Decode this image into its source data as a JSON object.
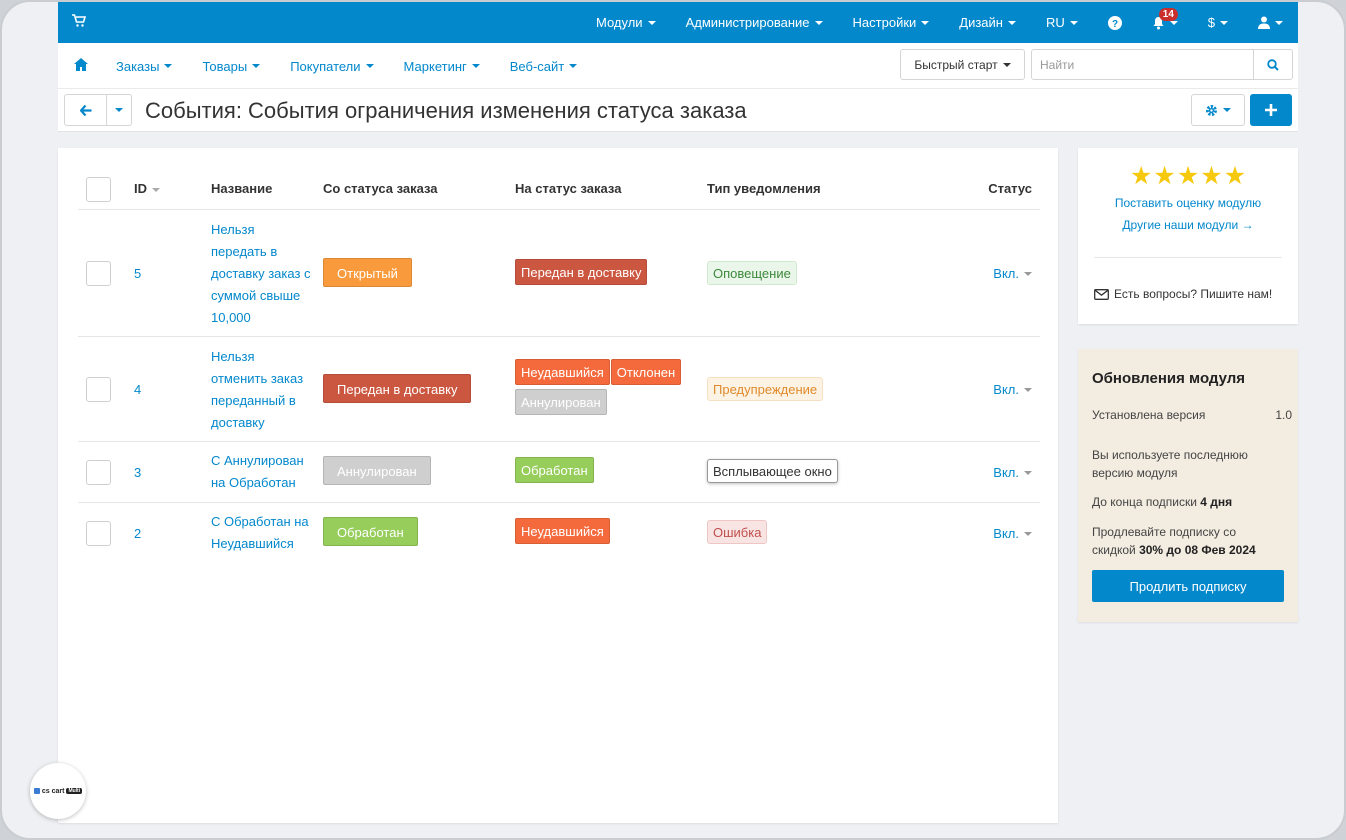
{
  "topbar": {
    "menu": [
      {
        "label": "Модули"
      },
      {
        "label": "Администрирование"
      },
      {
        "label": "Настройки"
      },
      {
        "label": "Дизайн"
      },
      {
        "label": "RU"
      }
    ],
    "notifications_count": "14",
    "currency": "$"
  },
  "subnav": {
    "links": [
      "Заказы",
      "Товары",
      "Покупатели",
      "Маркетинг",
      "Веб-сайт"
    ],
    "quick_start": "Быстрый старт",
    "search_placeholder": "Найти"
  },
  "page": {
    "title": "События: События ограничения изменения статуса заказа"
  },
  "table": {
    "headers": {
      "id": "ID",
      "name": "Название",
      "from_status": "Со статуса заказа",
      "to_status": "На статус заказа",
      "notification_type": "Тип уведомления",
      "status": "Статус"
    },
    "rows": [
      {
        "id": "5",
        "name": "Нельзя передать в доставку заказ с суммой свыше 10,000",
        "from": [
          {
            "label": "Открытый",
            "color": "#f99b3d"
          }
        ],
        "to": [
          {
            "label": "Передан в доставку",
            "color": "#cc5741"
          }
        ],
        "notification": {
          "label": "Оповещение",
          "fg": "#3c8a3c",
          "bg": "#eaf6ea",
          "border": "#cfe9cf"
        },
        "status": "Вкл."
      },
      {
        "id": "4",
        "name": "Нельзя отменить заказ переданный в доставку",
        "from": [
          {
            "label": "Передан в доставку",
            "color": "#cc5741"
          }
        ],
        "to": [
          {
            "label": "Неудавшийся",
            "color": "#f46a3c"
          },
          {
            "label": "Отклонен",
            "color": "#f46a3c"
          },
          {
            "label": "Аннулирован",
            "color": "#cfcfcf"
          }
        ],
        "notification": {
          "label": "Предупреждение",
          "fg": "#e08a2b",
          "bg": "#fdf3e4",
          "border": "#f6e0bf"
        },
        "status": "Вкл."
      },
      {
        "id": "3",
        "name": "С Аннулирован на Обработан",
        "from": [
          {
            "label": "Аннулирован",
            "color": "#cfcfcf"
          }
        ],
        "to": [
          {
            "label": "Обработан",
            "color": "#96cd5b"
          }
        ],
        "notification": {
          "label": "Всплывающее окно",
          "fg": "#333333",
          "bg": "#ffffff",
          "border": "#999999"
        },
        "status": "Вкл."
      },
      {
        "id": "2",
        "name": "С Обработан на Неудавшийся",
        "from": [
          {
            "label": "Обработан",
            "color": "#96cd5b"
          }
        ],
        "to": [
          {
            "label": "Неудавшийся",
            "color": "#f46a3c"
          }
        ],
        "notification": {
          "label": "Ошибка",
          "fg": "#c0504d",
          "bg": "#f9e4e4",
          "border": "#efc6c6"
        },
        "status": "Вкл."
      }
    ]
  },
  "sidebar": {
    "rate_link": "Поставить оценку модулю",
    "other_link": "Другие наши модули →",
    "contact": "Есть вопросы? Пишите нам!",
    "updates": {
      "title": "Обновления модуля",
      "installed_label": "Установлена версия",
      "installed_version": "1.0",
      "latest_text": "Вы используете последнюю версию модуля",
      "subscription_prefix": "До конца подписки ",
      "subscription_days": "4 дня",
      "promo_prefix": "Продлевайте подписку со скидкой ",
      "promo_bold": "30% до 08 Фев 2024",
      "renew_button": "Продлить подписку"
    }
  },
  "logo": {
    "text": "cs cart",
    "pill": "Multi"
  }
}
